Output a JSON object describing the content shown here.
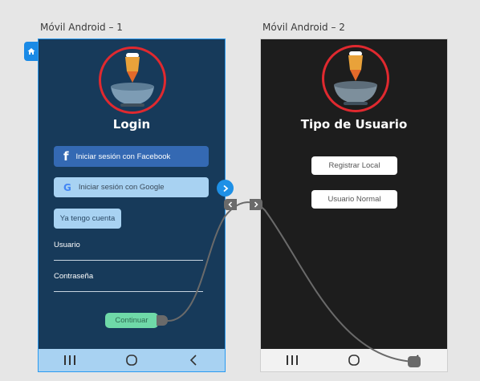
{
  "artboards": {
    "first_title": "Móvil Android – 1",
    "second_title": "Móvil Android – 2"
  },
  "login_screen": {
    "title": "Login",
    "facebook_label": "Iniciar sesión con Facebook",
    "google_label": "Iniciar sesión con Google",
    "have_account_label": "Ya tengo cuenta",
    "user_label": "Usuario",
    "password_label": "Contraseña",
    "continue_label": "Continuar"
  },
  "user_type_screen": {
    "title": "Tipo de Usuario",
    "register_label": "Registrar Local",
    "normal_user_label": "Usuario Normal"
  },
  "icons": {
    "home": "home-icon",
    "logo": "beer-mug-logo",
    "facebook": "facebook-icon",
    "google": "google-icon",
    "nav_recents": "recents-icon",
    "nav_home": "home-circle-icon",
    "nav_back": "back-icon",
    "flow": "chevron-right-icon"
  },
  "colors": {
    "login_bg": "#173a5a",
    "user_type_bg": "#1d1d1d",
    "accent": "#1e90e6",
    "facebook": "#3469b3",
    "light_button": "#a8d2f2",
    "continue": "#6fd9a8",
    "logo_ring": "#e0292f"
  }
}
